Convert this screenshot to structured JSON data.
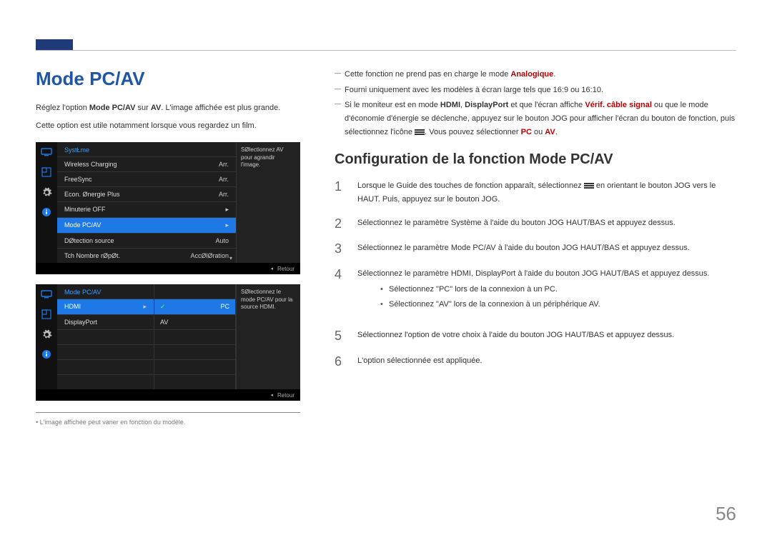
{
  "page": {
    "number": "56"
  },
  "title": "Mode PC/AV",
  "intro1_pre": "Réglez l'option ",
  "intro1_b1": "Mode PC/AV",
  "intro1_mid": " sur ",
  "intro1_b2": "AV",
  "intro1_post": ". L'image affichée est plus grande.",
  "intro2": "Cette option est utile notamment lorsque vous regardez un film.",
  "osd1": {
    "header": "SystŁme",
    "items": [
      {
        "label": "Wireless Charging",
        "value": "Arr."
      },
      {
        "label": "FreeSync",
        "value": "Arr."
      },
      {
        "label": "Econ. Ønergie Plus",
        "value": "Arr."
      },
      {
        "label": "Minuterie OFF",
        "value": "▸"
      },
      {
        "label": "Mode PC/AV",
        "value": "▸",
        "sel": true
      },
      {
        "label": "DØtection source",
        "value": "Auto"
      },
      {
        "label": "Tch Nombre rØpØt.",
        "value": "AccØlØration"
      }
    ],
    "help": "SØlectionnez AV pour agrandir l'image.",
    "footer": "Retour"
  },
  "osd2": {
    "header": "Mode PC/AV",
    "left": [
      {
        "label": "HDMI",
        "sel": true
      },
      {
        "label": "DisplayPort"
      }
    ],
    "right": [
      {
        "label": "PC",
        "sel": true
      },
      {
        "label": "AV"
      }
    ],
    "blank_rows": 4,
    "help": "SØlectionnez le mode PC/AV pour la source HDMI.",
    "footer": "Retour"
  },
  "footnote": "L'image affichée peut varier en fonction du modèle.",
  "dash": [
    {
      "parts": [
        {
          "t": "Cette fonction ne prend pas en charge le mode "
        },
        {
          "t": "Analogique",
          "cls": "red"
        },
        {
          "t": "."
        }
      ]
    },
    {
      "parts": [
        {
          "t": "Fourni uniquement avec les modèles à écran large tels que 16:9 ou 16:10."
        }
      ]
    },
    {
      "parts": [
        {
          "t": "Si le moniteur est en mode "
        },
        {
          "t": "HDMI",
          "cls": "b"
        },
        {
          "t": ", "
        },
        {
          "t": "DisplayPort",
          "cls": "b"
        },
        {
          "t": " et que l'écran affiche "
        },
        {
          "t": "Vérif. câble signal",
          "cls": "red"
        },
        {
          "t": " ou que le mode d'économie d'énergie se déclenche, appuyez sur le bouton JOG pour afficher l'écran du bouton de fonction, puis sélectionnez l'icône "
        },
        {
          "icon": true
        },
        {
          "t": ". Vous pouvez sélectionner "
        },
        {
          "t": "PC",
          "cls": "red"
        },
        {
          "t": " ou "
        },
        {
          "t": "AV",
          "cls": "red"
        },
        {
          "t": "."
        }
      ]
    }
  ],
  "subtitle": "Configuration de la fonction Mode PC/AV",
  "steps": [
    {
      "parts": [
        {
          "t": "Lorsque le Guide des touches de fonction apparaît, sélectionnez "
        },
        {
          "icon": true
        },
        {
          "t": " en orientant le bouton JOG vers le HAUT. Puis, appuyez sur le bouton JOG."
        }
      ]
    },
    {
      "parts": [
        {
          "t": "Sélectionnez le paramètre "
        },
        {
          "t": "Système",
          "cls": "red"
        },
        {
          "t": " à l'aide du bouton JOG HAUT/BAS et appuyez dessus."
        }
      ]
    },
    {
      "parts": [
        {
          "t": "Sélectionnez le paramètre "
        },
        {
          "t": "Mode PC/AV",
          "cls": "red"
        },
        {
          "t": " à l'aide du bouton JOG HAUT/BAS et appuyez dessus."
        }
      ]
    },
    {
      "parts": [
        {
          "t": "Sélectionnez le paramètre "
        },
        {
          "t": "HDMI",
          "cls": "b"
        },
        {
          "t": ", "
        },
        {
          "t": "DisplayPort",
          "cls": "b"
        },
        {
          "t": " à l'aide du bouton JOG HAUT/BAS et appuyez dessus."
        }
      ],
      "bullets": [
        {
          "parts": [
            {
              "t": "Sélectionnez \""
            },
            {
              "t": "PC",
              "cls": "b"
            },
            {
              "t": "\" lors de la connexion à un PC."
            }
          ]
        },
        {
          "parts": [
            {
              "t": "Sélectionnez \""
            },
            {
              "t": "AV",
              "cls": "b"
            },
            {
              "t": "\" lors de la connexion à un périphérique AV."
            }
          ]
        }
      ]
    },
    {
      "parts": [
        {
          "t": "Sélectionnez l'option de votre choix à l'aide du bouton JOG HAUT/BAS et appuyez dessus."
        }
      ]
    },
    {
      "parts": [
        {
          "t": "L'option sélectionnée est appliquée."
        }
      ]
    }
  ]
}
